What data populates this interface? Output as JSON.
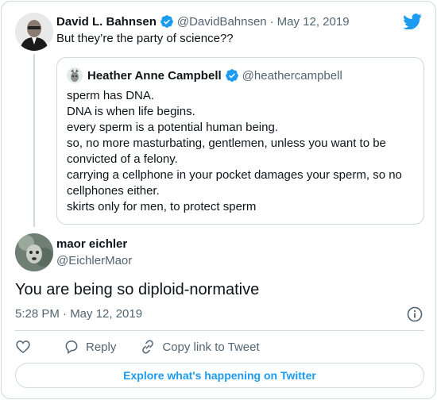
{
  "parent": {
    "name": "David L. Bahnsen",
    "handle": "@DavidBahnsen",
    "date": "May 12, 2019",
    "separator": "·",
    "text": "But they’re the party of science??"
  },
  "quote": {
    "name": "Heather Anne Campbell",
    "handle": "@heathercampbell",
    "lines": [
      "sperm has DNA.",
      "DNA is when life begins.",
      "every sperm is a potential human being.",
      "so, no more masturbating, gentlemen, unless you want to be",
      "convicted of a felony.",
      "carrying a cellphone in your pocket damages your sperm, so no",
      "cellphones either.",
      "skirts only for men, to protect sperm"
    ]
  },
  "main": {
    "name": "maor eichler",
    "handle": "@EichlerMaor",
    "text": "You are being so diploid-normative",
    "timestamp": "5:28 PM · May 12, 2019"
  },
  "actions": {
    "reply": "Reply",
    "copy_link": "Copy link to Tweet"
  },
  "explore": "Explore what's happening on Twitter",
  "colors": {
    "accent": "#1d9bf0",
    "text": "#0f1419",
    "secondary": "#536471",
    "border": "#cfd9de"
  },
  "icons": [
    "twitter-bird-icon",
    "verified-badge-icon",
    "info-icon",
    "heart-icon",
    "reply-icon",
    "link-icon"
  ]
}
